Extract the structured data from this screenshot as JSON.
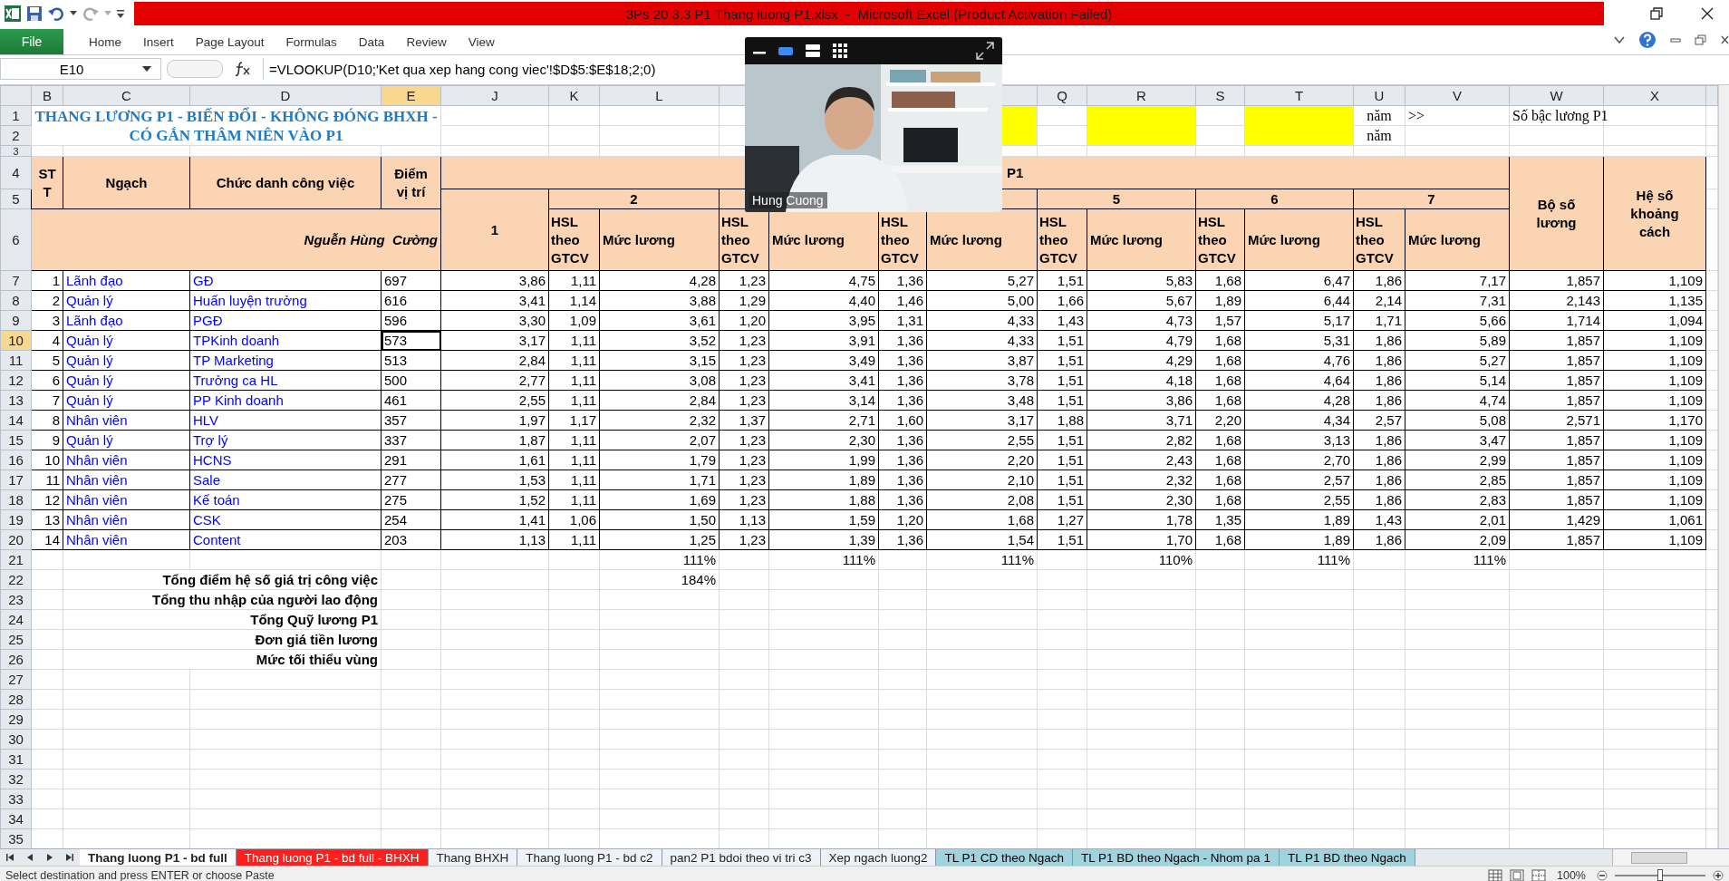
{
  "window": {
    "title": "3Ps 20 3.3 P1 Thang luong P1.xlsx  -  Microsoft Excel (Product Activation Failed)"
  },
  "ribbon": {
    "file_tab": "File",
    "tabs": [
      "Home",
      "Insert",
      "Page Layout",
      "Formulas",
      "Data",
      "Review",
      "View"
    ]
  },
  "formula_bar": {
    "name_box": "E10",
    "formula": "=VLOOKUP(D10;'Ket qua xep hang cong viec'!$D$5:$E$18;2;0)"
  },
  "columns": [
    {
      "letter": "B",
      "selected": false
    },
    {
      "letter": "C",
      "selected": false
    },
    {
      "letter": "D",
      "selected": false
    },
    {
      "letter": "E",
      "selected": true
    },
    {
      "letter": "J",
      "selected": false
    },
    {
      "letter": "K",
      "selected": false
    },
    {
      "letter": "L",
      "selected": false
    },
    {
      "letter": "Q",
      "selected": false
    },
    {
      "letter": "R",
      "selected": false
    },
    {
      "letter": "S",
      "selected": false
    },
    {
      "letter": "T",
      "selected": false
    },
    {
      "letter": "U",
      "selected": false
    },
    {
      "letter": "V",
      "selected": false
    },
    {
      "letter": "W",
      "selected": false
    },
    {
      "letter": "X",
      "selected": false
    }
  ],
  "row_headers": [
    {
      "label": "1",
      "selected": false
    },
    {
      "label": "2",
      "selected": false
    },
    {
      "label": "3",
      "selected": false
    },
    {
      "label": "4",
      "selected": false
    },
    {
      "label": "5",
      "selected": false
    },
    {
      "label": "6",
      "selected": false
    },
    {
      "label": "7",
      "selected": false
    },
    {
      "label": "8",
      "selected": false
    },
    {
      "label": "9",
      "selected": false
    },
    {
      "label": "10",
      "selected": true
    },
    {
      "label": "11",
      "selected": false
    },
    {
      "label": "12",
      "selected": false
    },
    {
      "label": "13",
      "selected": false
    },
    {
      "label": "14",
      "selected": false
    },
    {
      "label": "15",
      "selected": false
    },
    {
      "label": "16",
      "selected": false
    },
    {
      "label": "17",
      "selected": false
    },
    {
      "label": "18",
      "selected": false
    },
    {
      "label": "19",
      "selected": false
    },
    {
      "label": "20",
      "selected": false
    },
    {
      "label": "21",
      "selected": false
    },
    {
      "label": "22",
      "selected": false
    },
    {
      "label": "23",
      "selected": false
    },
    {
      "label": "24",
      "selected": false
    },
    {
      "label": "25",
      "selected": false
    },
    {
      "label": "26",
      "selected": false
    },
    {
      "label": "27",
      "selected": false
    },
    {
      "label": "28",
      "selected": false
    },
    {
      "label": "29",
      "selected": false
    },
    {
      "label": "30",
      "selected": false
    },
    {
      "label": "31",
      "selected": false
    },
    {
      "label": "32",
      "selected": false
    },
    {
      "label": "33",
      "selected": false
    },
    {
      "label": "34",
      "selected": false
    },
    {
      "label": "35",
      "selected": false
    }
  ],
  "title_lines": [
    "THANG LƯƠNG P1 - BIẾN ĐỔI - KHÔNG ĐÓNG BHXH -",
    "CÓ GẮN THÂM NIÊN VÀO P1"
  ],
  "notes": {
    "unit_1": "năm",
    "arrow": ">>",
    "label": "Số bậc lương P1",
    "unit_2": "năm"
  },
  "header": {
    "stt": "ST T",
    "grade": "Ngạch",
    "job_title": "Chức danh công việc",
    "score": "Điểm vị trí",
    "scale": "P1",
    "author": "Nguễn Hùng  Cường",
    "coef_set": "Bộ số lương",
    "distance": "Hệ số khoảng cách",
    "groups": [
      {
        "label": "1"
      },
      {
        "label": "2",
        "hsl_label": "HSL theo GTCV",
        "salary_label": "Mức lương"
      },
      {
        "hsl_label": "HSL theo GTCV",
        "salary_label": "Mức lương"
      },
      {
        "hsl_label": "HSL theo GTCV",
        "salary_label": "Mức lương"
      },
      {
        "label": "5",
        "hsl_label": "HSL theo GTCV",
        "salary_label": "Mức lương"
      },
      {
        "label": "6",
        "hsl_label": "HSL theo GTCV",
        "salary_label": "Mức lương"
      },
      {
        "label": "7",
        "hsl_label": "HSL theo GTCV",
        "salary_label": "Mức lương"
      }
    ]
  },
  "rows": [
    {
      "stt": "1",
      "grade": "Lãnh đạo",
      "job": "GĐ",
      "score": "697",
      "values": [
        "3,86",
        "1,11",
        "4,28",
        "1,23",
        "4,75",
        "1,36",
        "5,27",
        "1,51",
        "5,83",
        "1,68",
        "6,47",
        "1,86",
        "7,17",
        "1,857",
        "1,109"
      ]
    },
    {
      "stt": "2",
      "grade": "Quản lý",
      "job": "Huấn luyện trưởng",
      "score": "616",
      "values": [
        "3,41",
        "1,14",
        "3,88",
        "1,29",
        "4,40",
        "1,46",
        "5,00",
        "1,66",
        "5,67",
        "1,89",
        "6,44",
        "2,14",
        "7,31",
        "2,143",
        "1,135"
      ]
    },
    {
      "stt": "3",
      "grade": "Lãnh đạo",
      "job": "PGĐ",
      "score": "596",
      "values": [
        "3,30",
        "1,09",
        "3,61",
        "1,20",
        "3,95",
        "1,31",
        "4,33",
        "1,43",
        "4,73",
        "1,57",
        "5,17",
        "1,71",
        "5,66",
        "1,714",
        "1,094"
      ]
    },
    {
      "stt": "4",
      "grade": "Quản lý",
      "job": "TPKinh doanh",
      "score": "573",
      "values": [
        "3,17",
        "1,11",
        "3,52",
        "1,23",
        "3,91",
        "1,36",
        "4,33",
        "1,51",
        "4,79",
        "1,68",
        "5,31",
        "1,86",
        "5,89",
        "1,857",
        "1,109"
      ]
    },
    {
      "stt": "5",
      "grade": "Quản lý",
      "job": "TP Marketing",
      "score": "513",
      "values": [
        "2,84",
        "1,11",
        "3,15",
        "1,23",
        "3,49",
        "1,36",
        "3,87",
        "1,51",
        "4,29",
        "1,68",
        "4,76",
        "1,86",
        "5,27",
        "1,857",
        "1,109"
      ]
    },
    {
      "stt": "6",
      "grade": "Quản lý",
      "job": "Trưởng ca HL",
      "score": "500",
      "values": [
        "2,77",
        "1,11",
        "3,08",
        "1,23",
        "3,41",
        "1,36",
        "3,78",
        "1,51",
        "4,18",
        "1,68",
        "4,64",
        "1,86",
        "5,14",
        "1,857",
        "1,109"
      ]
    },
    {
      "stt": "7",
      "grade": "Quản lý",
      "job": "PP Kinh doanh",
      "score": "461",
      "values": [
        "2,55",
        "1,11",
        "2,84",
        "1,23",
        "3,14",
        "1,36",
        "3,48",
        "1,51",
        "3,86",
        "1,68",
        "4,28",
        "1,86",
        "4,74",
        "1,857",
        "1,109"
      ]
    },
    {
      "stt": "8",
      "grade": "Nhân viên",
      "job": "HLV",
      "score": "357",
      "values": [
        "1,97",
        "1,17",
        "2,32",
        "1,37",
        "2,71",
        "1,60",
        "3,17",
        "1,88",
        "3,71",
        "2,20",
        "4,34",
        "2,57",
        "5,08",
        "2,571",
        "1,170"
      ]
    },
    {
      "stt": "9",
      "grade": "Quản lý",
      "job": "Trợ lý",
      "score": "337",
      "values": [
        "1,87",
        "1,11",
        "2,07",
        "1,23",
        "2,30",
        "1,36",
        "2,55",
        "1,51",
        "2,82",
        "1,68",
        "3,13",
        "1,86",
        "3,47",
        "1,857",
        "1,109"
      ]
    },
    {
      "stt": "10",
      "grade": "Nhân viên",
      "job": "HCNS",
      "score": "291",
      "values": [
        "1,61",
        "1,11",
        "1,79",
        "1,23",
        "1,99",
        "1,36",
        "2,20",
        "1,51",
        "2,43",
        "1,68",
        "2,70",
        "1,86",
        "2,99",
        "1,857",
        "1,109"
      ]
    },
    {
      "stt": "11",
      "grade": "Nhân viên",
      "job": "Sale",
      "score": "277",
      "values": [
        "1,53",
        "1,11",
        "1,71",
        "1,23",
        "1,89",
        "1,36",
        "2,10",
        "1,51",
        "2,32",
        "1,68",
        "2,57",
        "1,86",
        "2,85",
        "1,857",
        "1,109"
      ]
    },
    {
      "stt": "12",
      "grade": "Nhân viên",
      "job": "Kế toán",
      "score": "275",
      "values": [
        "1,52",
        "1,11",
        "1,69",
        "1,23",
        "1,88",
        "1,36",
        "2,08",
        "1,51",
        "2,30",
        "1,68",
        "2,55",
        "1,86",
        "2,83",
        "1,857",
        "1,109"
      ]
    },
    {
      "stt": "13",
      "grade": "Nhân viên",
      "job": "CSK",
      "score": "254",
      "values": [
        "1,41",
        "1,06",
        "1,50",
        "1,13",
        "1,59",
        "1,20",
        "1,68",
        "1,27",
        "1,78",
        "1,35",
        "1,89",
        "1,43",
        "2,01",
        "1,429",
        "1,061"
      ]
    },
    {
      "stt": "14",
      "grade": "Nhân viên",
      "job": "Content",
      "score": "203",
      "values": [
        "1,13",
        "1,11",
        "1,25",
        "1,23",
        "1,39",
        "1,36",
        "1,54",
        "1,51",
        "1,70",
        "1,68",
        "1,89",
        "1,86",
        "2,09",
        "1,857",
        "1,109"
      ]
    }
  ],
  "percent_row": [
    "111%",
    "111%",
    "111%",
    "110%",
    "111%",
    "111%"
  ],
  "share": "184%",
  "summary_labels": [
    "Tổng điểm hệ số giá trị công việc",
    "Tổng thu nhập của người lao động",
    "Tổng Quỹ lương P1",
    "Đơn giá tiền lương",
    "Mức tối thiểu vùng"
  ],
  "video": {
    "name": "Hung Cuong"
  },
  "sheet_tabs": [
    {
      "label": "Thang luong P1 - bd full",
      "selected": true
    },
    {
      "label": "Thang luong P1 - bd full - BHXH",
      "selected": false,
      "color": "#ff1f1f"
    },
    {
      "label": "Thang BHXH",
      "selected": false
    },
    {
      "label": "Thang luong P1 - bd c2",
      "selected": false
    },
    {
      "label": "pan2 P1 bdoi theo vi tri c3",
      "selected": false
    },
    {
      "label": "Xep ngach luong2",
      "selected": false
    },
    {
      "label": "TL P1 CD theo Ngach",
      "selected": false,
      "color": "#9fd3dd"
    },
    {
      "label": "TL P1 BD theo Ngach - Nhom pa 1",
      "selected": false,
      "color": "#9fd3dd"
    },
    {
      "label": "TL P1 BD theo Ngach",
      "selected": false,
      "color": "#9fd3dd"
    }
  ],
  "status_bar": {
    "message": "Select destination and press ENTER or choose Paste",
    "zoom": "100%",
    "zoom_slider": {
      "level": 0.5
    }
  }
}
